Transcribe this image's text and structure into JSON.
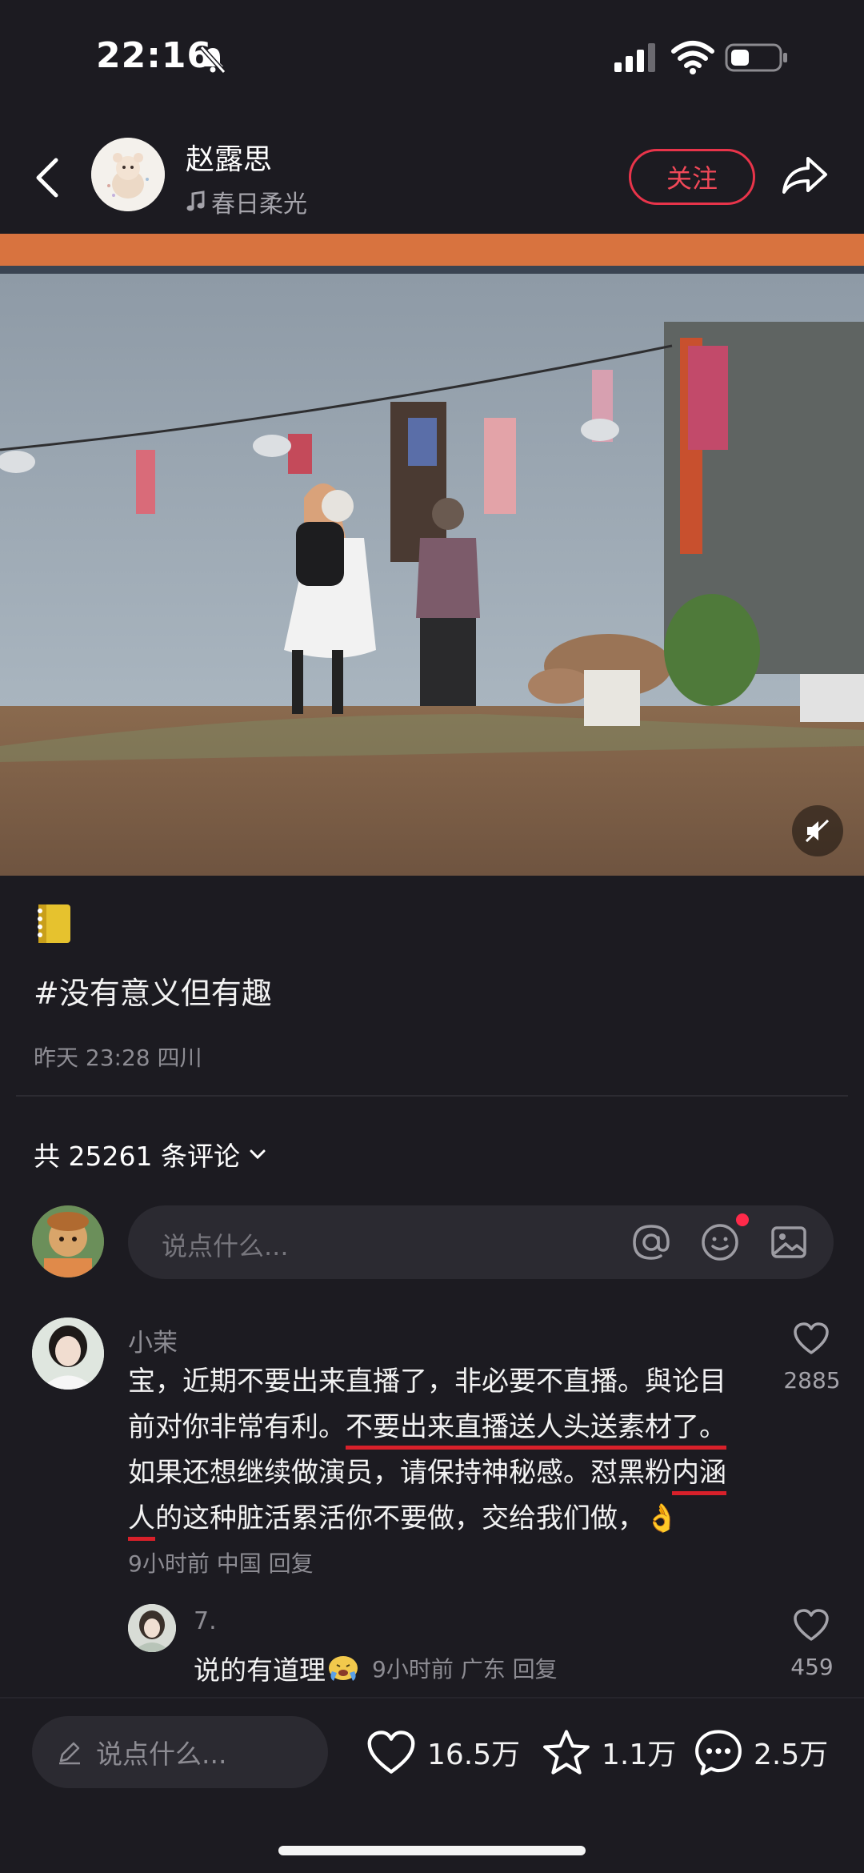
{
  "status_bar": {
    "time": "22:16",
    "icons": [
      "bell-muted-icon",
      "signal-icon",
      "wifi-icon",
      "battery-icon"
    ]
  },
  "header": {
    "author_name": "赵露思",
    "music_title": "春日柔光",
    "follow_label": "关注",
    "icons": [
      "back-icon",
      "music-note-icon",
      "share-icon"
    ],
    "accent_color": "#e8344a"
  },
  "post": {
    "image_description_icon": "photo",
    "emoji_icon": "notebook-icon",
    "text": "#没有意义但有趣",
    "meta": "昨天 23:28 四川"
  },
  "comments_header": {
    "count_label": "共 25261 条评论"
  },
  "comment_input": {
    "placeholder": "说点什么...",
    "icons": [
      "at-icon",
      "emoji-icon",
      "image-icon"
    ]
  },
  "comments": [
    {
      "user": "小茉",
      "body_parts": [
        "宝，近期不要出来直播了，非必要不直播。與论目前对你非常有利。",
        "不要出来直播送人头送素材了。",
        "如果还想继续做演员，请保持神秘感。怼黑粉",
        "内涵人",
        "的这种脏活累活你不要做，交给我们做，"
      ],
      "emoji": "👌",
      "meta": "9小时前 中国 回复",
      "likes": "2885"
    }
  ],
  "replies": [
    {
      "user": "7.",
      "body": "说的有道理",
      "meta": "9小时前 广东 回复",
      "likes": "459"
    }
  ],
  "bottom_bar": {
    "placeholder": "说点什么...",
    "likes": "16.5万",
    "stars": "1.1万",
    "comments": "2.5万"
  }
}
